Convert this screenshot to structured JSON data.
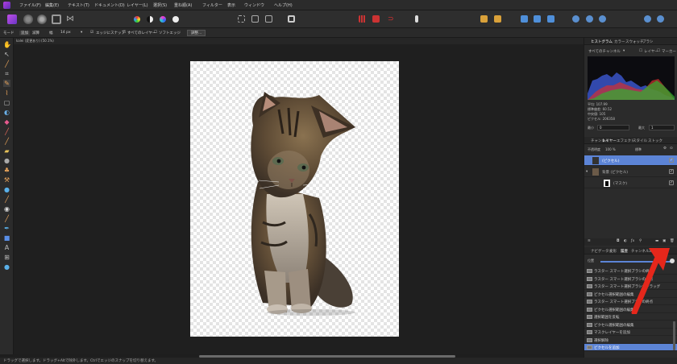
{
  "menu": [
    "ファイル(F)",
    "編集(E)",
    "テキスト(T)",
    "ドキュメント(D)",
    "レイヤー(L)",
    "選択(S)",
    "選択(S)",
    "重ね順(A)",
    "フィルター",
    "表示",
    "ウィンドウ",
    "ヘルプ(H)"
  ],
  "menu_items": [
    "ファイル(F)",
    "編集(E)",
    "テキスト(T)",
    "ドキュメント(D)",
    "レイヤー(L)",
    "選択(S)",
    "重ね順(A)",
    "フィルター",
    "表示",
    "ウィンドウ",
    "ヘルプ(H)"
  ],
  "context": {
    "mode_label": "モード",
    "mode_add": "追加",
    "mode_sub": "減算",
    "width_label": "幅",
    "width_value": "14 px",
    "snap": "エッジにスナップ",
    "all_layers": "すべてのレイヤー",
    "soft_edge": "ソフトエッジ",
    "refine": "調整..."
  },
  "doc_tab": "kalei (変更あり) (50.1%)",
  "status": "ドラッグで選択します。ドラッグ+Altで除外します。Ctrlでエッジのスナップを切り替えます。",
  "histogram": {
    "tabs": [
      "ヒストグラム",
      "カラー",
      "スウォッチ",
      "ブラシ"
    ],
    "channel": "すべてのチャンネル",
    "layer_label": "レイヤー",
    "marker_label": "マーカー",
    "stats": [
      "平均: 107.99",
      "標準偏差: 60.52",
      "中央値: 105",
      "ピクセル: 206358"
    ],
    "min_label": "最小",
    "min_value": "0",
    "max_label": "最大",
    "max_value": "1"
  },
  "layers": {
    "tabs": [
      "チャンネル",
      "レイヤー",
      "エフェクト",
      "スタイル",
      "ストック"
    ],
    "opacity_label": "不透明度",
    "opacity_value": "100 %",
    "blend_value": "標準",
    "items": [
      "(ピクセル)",
      "背景",
      "(ピクセル)",
      "(マスク)"
    ]
  },
  "history": {
    "tabs": [
      "ナビゲーター",
      "変形",
      "履歴",
      "チャンネル",
      "32ビット"
    ],
    "position_label": "位置",
    "items": [
      "ラスター スマート選択ブラシの終点",
      "ラスター スマート選択ブラシの終点",
      "ラスター スマート選択ブラシのドラッグ",
      "ピクセル選択範囲の編集",
      "ラスター スマート選択ブラシの終点",
      "ピクセル選択範囲の編集",
      "選択範囲を反転",
      "ピクセル選択範囲の編集",
      "マスクレイヤーを追加",
      "選択解除",
      "ピクセルを追加"
    ]
  },
  "colors": {
    "accent": "#5c84d6",
    "arrow": "#e5271b",
    "bg": "#1e1e1e"
  }
}
